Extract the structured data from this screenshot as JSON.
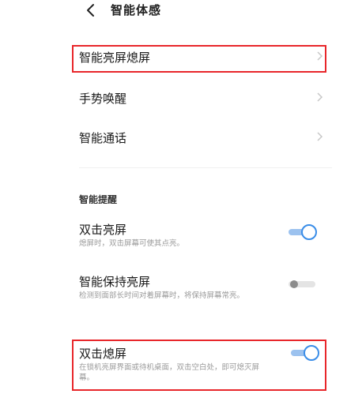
{
  "header": {
    "title": "智能体感"
  },
  "nav_items": [
    {
      "label": "智能亮屏熄屏"
    },
    {
      "label": "手势唤醒"
    },
    {
      "label": "智能通话"
    }
  ],
  "section": {
    "title": "智能提醒"
  },
  "toggles": [
    {
      "label": "双击亮屏",
      "description": "熄屏时，双击屏幕可使其点亮。",
      "state": "on"
    },
    {
      "label": "智能保持亮屏",
      "description": "检测到面部长时间对着屏幕时，将保持屏幕常亮。",
      "state": "off"
    },
    {
      "label": "双击熄屏",
      "description": "在锁机亮屏界面或待机桌面，双击空白处，即可熄灭屏幕。",
      "state": "on"
    }
  ],
  "colors": {
    "accent": "#3a8de8",
    "highlight": "#e8262a"
  },
  "icons": {
    "back": "chevron-left-icon",
    "nav": "chevron-right-icon"
  }
}
